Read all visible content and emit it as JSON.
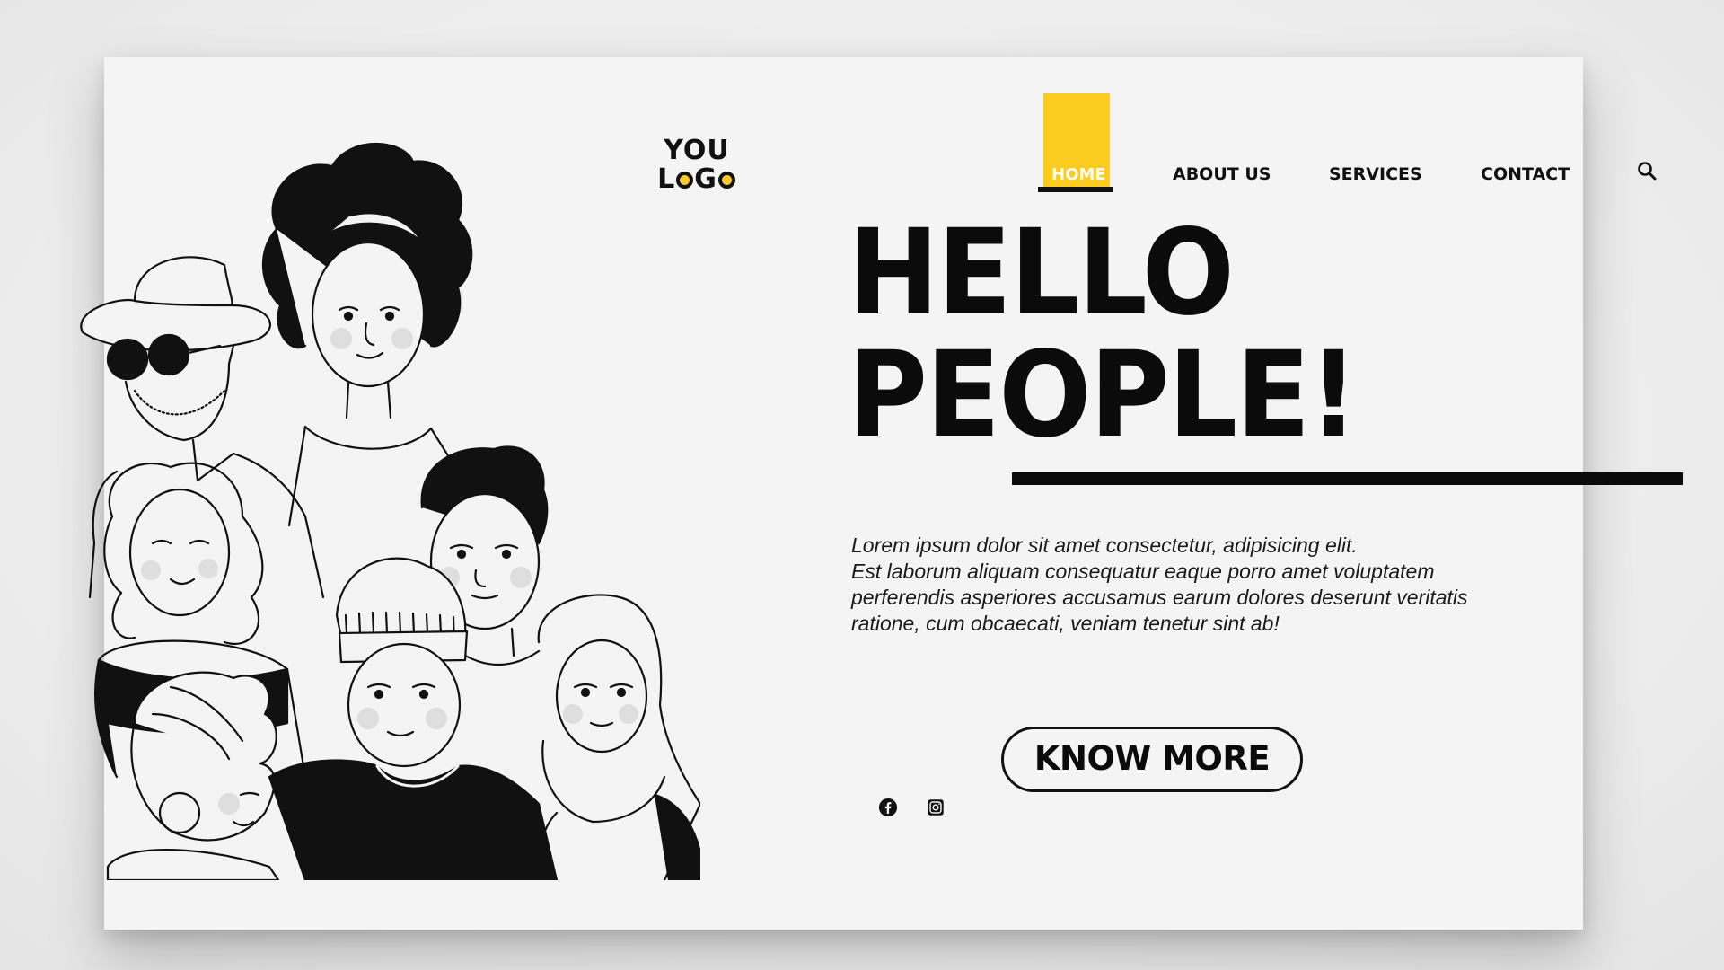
{
  "logo": {
    "line1": "YOU",
    "line2_a": "L",
    "line2_b": "G",
    "line2_c": ""
  },
  "nav": {
    "items": [
      {
        "label": "HOME",
        "active": true
      },
      {
        "label": "ABOUT US",
        "active": false
      },
      {
        "label": "SERVICES",
        "active": false
      },
      {
        "label": "CONTACT",
        "active": false
      }
    ],
    "search_icon": "search-icon"
  },
  "hero": {
    "title_line1": "HELLO",
    "title_line2": "PEOPLE!",
    "body_lines": [
      "Lorem ipsum dolor sit amet consectetur, adipisicing elit.",
      "Est laborum aliquam consequatur eaque porro amet voluptatem",
      "perferendis asperiores accusamus earum dolores deserunt veritatis",
      "ratione, cum obcaecati, veniam tenetur sint ab!"
    ],
    "cta_label": "KNOW MORE"
  },
  "social": {
    "icons": [
      "facebook-icon",
      "instagram-icon"
    ]
  },
  "illustration": {
    "icon": "group-of-people-illustration"
  },
  "colors": {
    "accent": "#fccb20",
    "text": "#0b0b0b",
    "background": "#f4f4f4"
  }
}
